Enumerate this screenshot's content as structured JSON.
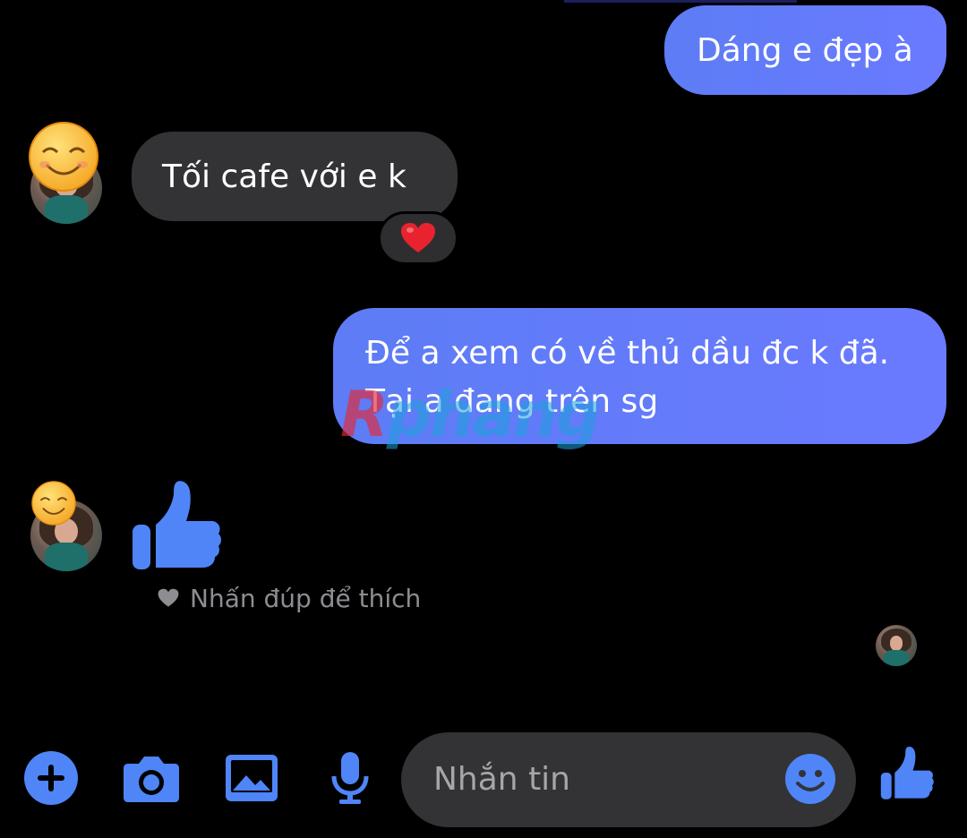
{
  "conversation": {
    "messages": [
      {
        "id": "msg1",
        "direction": "outgoing",
        "text": "Dáng e đẹp à"
      },
      {
        "id": "msg2",
        "direction": "incoming",
        "text": "Tối cafe với e k",
        "reaction": "heart"
      },
      {
        "id": "msg3",
        "direction": "outgoing",
        "lines": [
          "Để a xem có về thủ dầu đc k đã.",
          "Tại a đang trên sg"
        ]
      },
      {
        "id": "msg4",
        "direction": "incoming",
        "sticker": "thumbs-up-icon"
      }
    ],
    "hint": "Nhấn đúp để thích",
    "watermark": {
      "first": "R",
      "rest": "phang"
    }
  },
  "composer": {
    "placeholder": "Nhắn tin",
    "buttons": [
      "plus-icon",
      "camera-icon",
      "gallery-icon",
      "microphone-icon",
      "emoji-icon",
      "thumbs-up-icon"
    ]
  },
  "colors": {
    "accent": "#4f85f7",
    "outgoing_bubble": "#6a7aff",
    "incoming_bubble": "#333336",
    "background": "#000000",
    "hint_text": "#8d8d92",
    "reaction_heart": "#e8232f"
  }
}
